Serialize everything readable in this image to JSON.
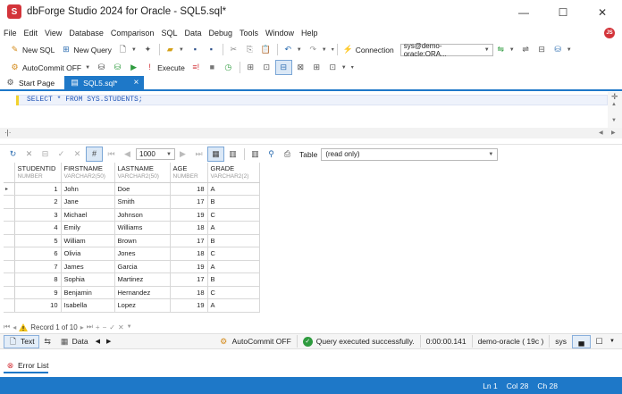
{
  "window": {
    "title": "dbForge Studio 2024 for Oracle - SQL5.sql*",
    "logo_letter": "S",
    "minimize": "—",
    "maximize": "☐",
    "close": "✕"
  },
  "menu": [
    "File",
    "Edit",
    "View",
    "Database",
    "Comparison",
    "SQL",
    "Data",
    "Debug",
    "Tools",
    "Window",
    "Help"
  ],
  "notification_badge": "JS",
  "toolbar1": {
    "new_sql": "New SQL",
    "new_query": "New Query",
    "connection_label": "Connection",
    "connection_value": "sys@demo-oracle:ORA..."
  },
  "toolbar2": {
    "autocommit": "AutoCommit OFF",
    "execute": "Execute"
  },
  "tabs": [
    {
      "label": "Start Page"
    },
    {
      "label": "SQL5.sql*",
      "close": "×"
    }
  ],
  "editor": {
    "sql": "SELECT * FROM SYS.STUDENTS;"
  },
  "grid_toolbar": {
    "page_size": "1000",
    "view_label": "Table",
    "view_value": "(read only)"
  },
  "grid": {
    "columns": [
      {
        "name": "STUDENTID",
        "type": "NUMBER"
      },
      {
        "name": "FIRSTNAME",
        "type": "VARCHAR2(50)"
      },
      {
        "name": "LASTNAME",
        "type": "VARCHAR2(50)"
      },
      {
        "name": "AGE",
        "type": "NUMBER"
      },
      {
        "name": "GRADE",
        "type": "VARCHAR2(2)"
      }
    ],
    "rows": [
      [
        "1",
        "John",
        "Doe",
        "18",
        "A"
      ],
      [
        "2",
        "Jane",
        "Smith",
        "17",
        "B"
      ],
      [
        "3",
        "Michael",
        "Johnson",
        "19",
        "C"
      ],
      [
        "4",
        "Emily",
        "Williams",
        "18",
        "A"
      ],
      [
        "5",
        "William",
        "Brown",
        "17",
        "B"
      ],
      [
        "6",
        "Olivia",
        "Jones",
        "18",
        "C"
      ],
      [
        "7",
        "James",
        "Garcia",
        "19",
        "A"
      ],
      [
        "8",
        "Sophia",
        "Martinez",
        "17",
        "B"
      ],
      [
        "9",
        "Benjamin",
        "Hernandez",
        "18",
        "C"
      ],
      [
        "10",
        "Isabella",
        "Lopez",
        "19",
        "A"
      ]
    ],
    "current_row_marker": "▸"
  },
  "record_nav": {
    "text": "Record 1 of 10"
  },
  "status_row": {
    "text_tab": "Text",
    "data_tab": "Data",
    "autocommit": "AutoCommit OFF",
    "message": "Query executed successfully.",
    "elapsed": "0:00:00.141",
    "server": "demo-oracle ( 19c )",
    "user": "sys"
  },
  "error_list": "Error List",
  "bottom_status": {
    "ln": "Ln 1",
    "col": "Col 28",
    "ch": "Ch 28"
  },
  "colors": {
    "accent": "#1e78c8",
    "brand": "#d3343a",
    "success": "#2e9b3e",
    "sql_keyword": "#2357b8"
  }
}
